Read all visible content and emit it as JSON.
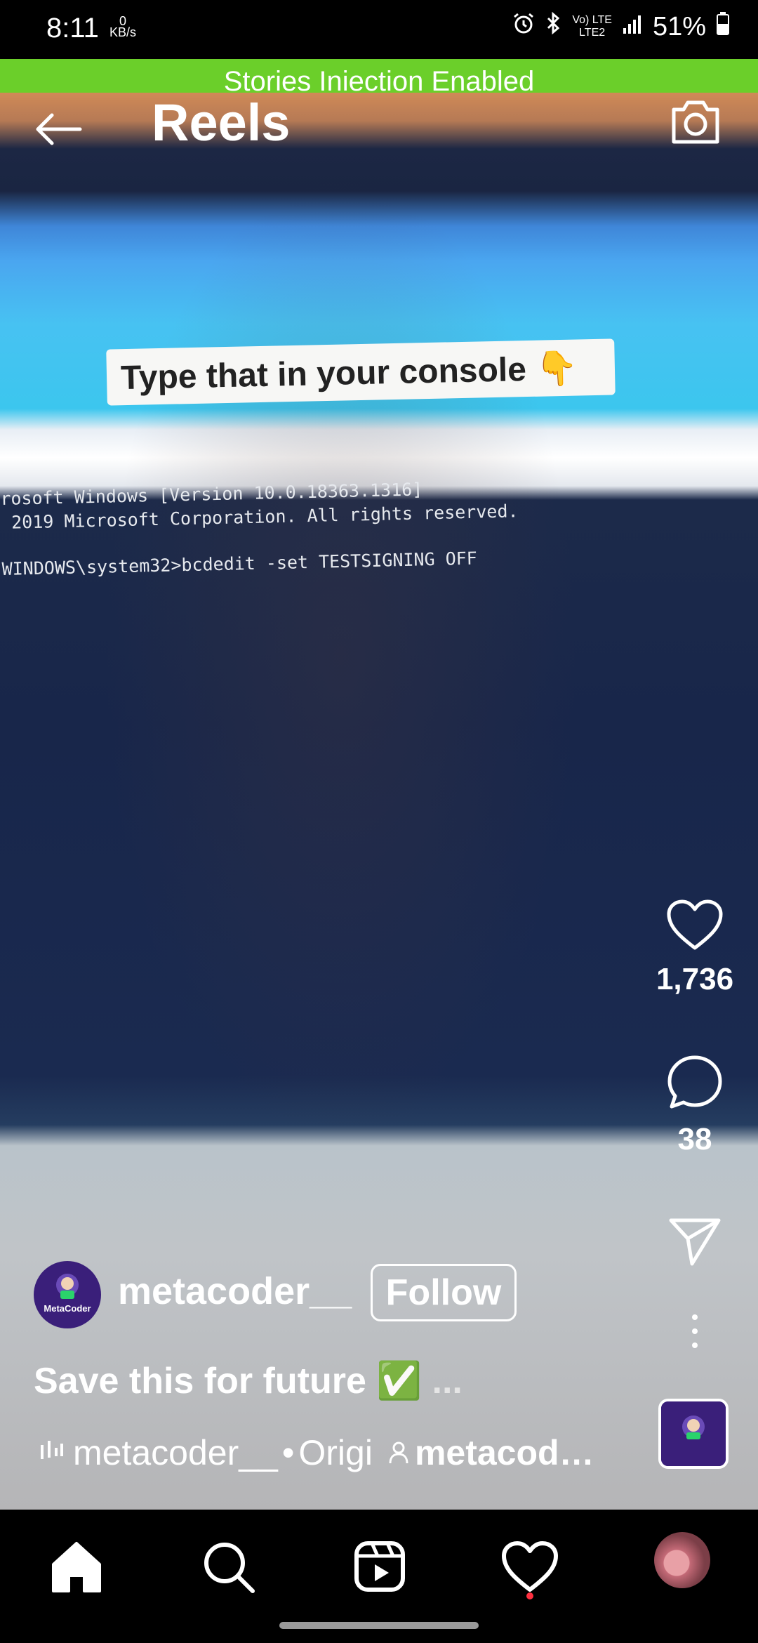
{
  "status_bar": {
    "time": "8:11",
    "speed_value": "0",
    "speed_unit": "KB/s",
    "net_label_top": "Vo) LTE",
    "net_label_bottom": "LTE2",
    "battery": "51%"
  },
  "banner": {
    "text": "Stories Iniection Enabled"
  },
  "header": {
    "title": "Reels"
  },
  "video": {
    "overlay_caption": "Type that in your console 👇",
    "console_lines": [
      "rosoft Windows [Version 10.0.18363.1316]",
      " 2019 Microsoft Corporation. All rights reserved.",
      "",
      "WINDOWS\\system32>bcdedit -set TESTSIGNING OFF"
    ]
  },
  "actions": {
    "likes": "1,736",
    "comments": "38"
  },
  "post": {
    "username": "metacoder__",
    "follow_label": "Follow",
    "avatar_label": "MetaCoder",
    "caption": "Save this for future ✅",
    "caption_more": " ...",
    "audio_user": "metacoder__",
    "audio_type": "Origi",
    "tagged_user": "metacod…"
  },
  "colors": {
    "banner": "#6bcf2a",
    "notification_dot": "#ff3040",
    "avatar_bg": "#3a1f7a"
  },
  "nav": {
    "items": [
      "home-icon",
      "search-icon",
      "reels-icon",
      "heart-icon",
      "profile-avatar"
    ]
  }
}
